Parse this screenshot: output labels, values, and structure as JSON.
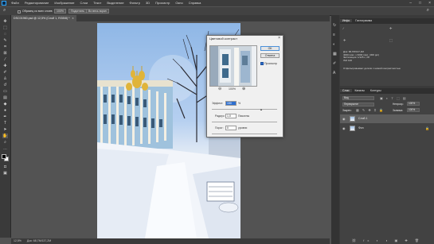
{
  "menubar": {
    "items": [
      "Файл",
      "Редактирование",
      "Изображение",
      "Слои",
      "Текст",
      "Выделение",
      "Фильтр",
      "3D",
      "Просмотр",
      "Окно",
      "Справка"
    ]
  },
  "options_bar": {
    "sample_all_layers": "Образец со всех слоев",
    "zoom_percent": "100%",
    "fit_button": "Подогнать",
    "fill_screen_button": "Во весь экран"
  },
  "document": {
    "tab_title": "DSC01960.psd @ 12,5% (Слой 1, RGB/8) *"
  },
  "status_bar": {
    "zoom": "12,5%",
    "doc_info": "Док: 68,7М/137,2М"
  },
  "right_panel": {
    "top_tabs": [
      "Инфо",
      "Гистограмма"
    ],
    "info_lines": [
      "Док: 68,7М/137,2М",
      "4000 пикс. x 6000 пикс. (300 ppi)",
      "Экспозиция: 1/125 с, f/8",
      "ISO 100"
    ],
    "hint_text": "Отфильтровывает детали с низкой контрастностью",
    "layers_tabs": [
      "Слои",
      "Каналы",
      "Контуры"
    ],
    "layer_kind": "Вид",
    "blend_mode": "Перекрытие",
    "opacity_label": "Непрозр.:",
    "opacity_value": "100%",
    "lock_label": "Закреп.:",
    "fill_label": "Заливка:",
    "fill_value": "100%",
    "layers": [
      {
        "name": "Слой 1",
        "selected": true
      },
      {
        "name": "Фон",
        "selected": false
      }
    ]
  },
  "dialog": {
    "title": "Цветовой контраст",
    "ok": "ОК",
    "cancel": "Отмена",
    "preview_label": "Просмотр",
    "preview_checked": true,
    "zoom_value": "100%",
    "effect_label": "Эффект:",
    "effect_value": "150",
    "effect_unit": "%",
    "radius_label": "Радиус:",
    "radius_value": "1,0",
    "radius_unit": "Пикселы",
    "threshold_label": "Порог:",
    "threshold_value": "0",
    "threshold_unit": "уровни"
  },
  "colors": {
    "accent": "#31a8ff",
    "app_bg": "#535353",
    "panel_bg": "#3a3a3a"
  }
}
